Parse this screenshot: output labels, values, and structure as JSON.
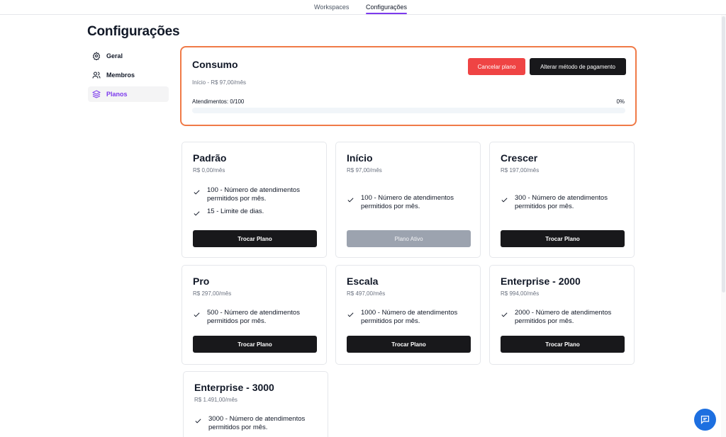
{
  "nav": {
    "tabs": [
      {
        "label": "Workspaces"
      },
      {
        "label": "Configurações"
      }
    ]
  },
  "page": {
    "title": "Configurações"
  },
  "sidebar": {
    "items": [
      {
        "label": "Geral",
        "icon": "gear-icon"
      },
      {
        "label": "Membros",
        "icon": "users-icon"
      },
      {
        "label": "Planos",
        "icon": "layers-icon"
      }
    ]
  },
  "usage": {
    "title": "Consumo",
    "plan_line": "Início - R$ 97,00/mês",
    "cancel_label": "Cancelar plano",
    "change_payment_label": "Alterar método de pagamento",
    "attendance_label": "Atendimentos: 0/100",
    "percent_label": "0%",
    "progress_fraction": 0
  },
  "plans": [
    {
      "name": "Padrão",
      "price": "R$ 0,00/mês",
      "features": [
        "100 - Número de atendimentos permitidos por mês.",
        "15 - Limite de dias."
      ],
      "button": "Trocar Plano"
    },
    {
      "name": "Início",
      "price": "R$ 97,00/mês",
      "features": [
        "100 - Número de atendimentos permitidos por mês."
      ],
      "button": "Plano Ativo"
    },
    {
      "name": "Crescer",
      "price": "R$ 197,00/mês",
      "features": [
        "300 - Número de atendimentos permitidos por mês."
      ],
      "button": "Trocar Plano"
    },
    {
      "name": "Pro",
      "price": "R$ 297,00/mês",
      "features": [
        "500 - Número de atendimentos permitidos por mês."
      ],
      "button": "Trocar Plano"
    },
    {
      "name": "Escala",
      "price": "R$ 497,00/mês",
      "features": [
        "1000 - Número de atendimentos permitidos por mês."
      ],
      "button": "Trocar Plano"
    },
    {
      "name": "Enterprise - 2000",
      "price": "R$ 994,00/mês",
      "features": [
        "2000 - Número de atendimentos permitidos por mês."
      ],
      "button": "Trocar Plano"
    },
    {
      "name": "Enterprise - 3000",
      "price": "R$ 1.491,00/mês",
      "features": [
        "3000 - Número de atendimentos permitidos por mês."
      ]
    }
  ],
  "colors": {
    "accent": "#7c3aed",
    "highlight_border": "#f07a47",
    "danger": "#ef4444",
    "dark_button": "#18181b",
    "chat": "#1d6fe0"
  }
}
